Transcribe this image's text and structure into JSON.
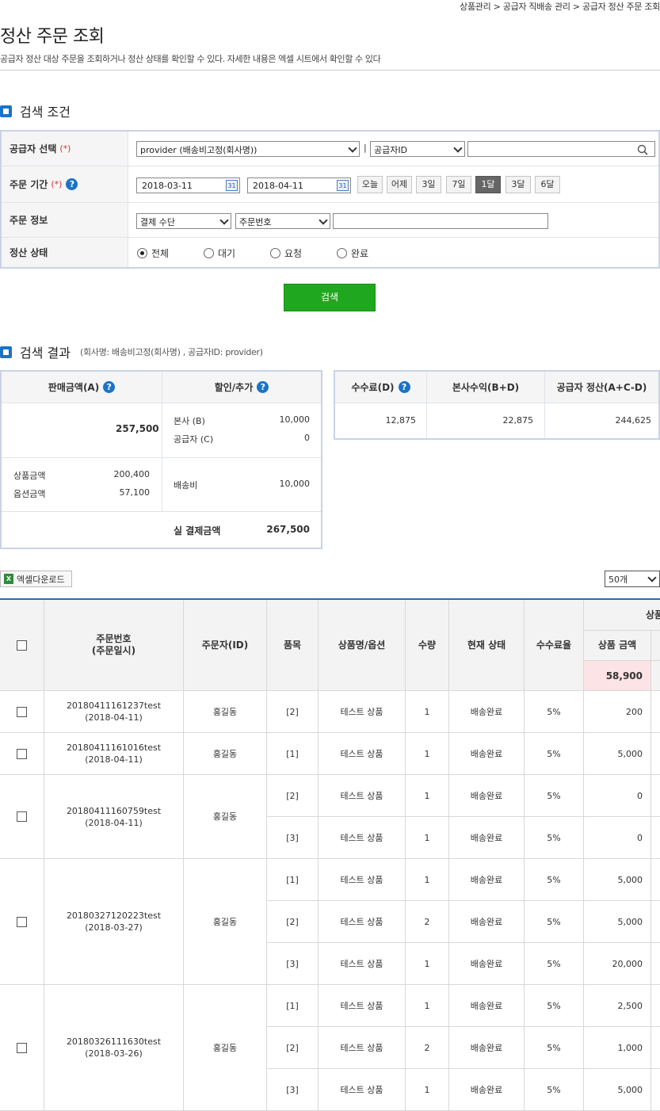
{
  "breadcrumb": "상품관리 > 공급자 직배송 관리 > 공급자 정산 주문 조회",
  "page": {
    "title": "정산 주문 조회",
    "description": "공급자 정산 대상 주문을 조회하거나 정산 상태를 확인할 수 있다. 자세한 내용은 엑셀 시트에서 확인할 수 있다"
  },
  "search": {
    "title": "검색 조건",
    "required_mark": "(*)",
    "supplier": {
      "label": "공급자 선택",
      "select_value": "provider (배송비고정(회사명))",
      "separator": "|",
      "type_value": "공급자ID",
      "input_value": ""
    },
    "period": {
      "label": "주문 기간",
      "start": "2018-03-11",
      "end": "2018-04-11",
      "calendar_glyph": "31",
      "buttons": [
        "오늘",
        "어제",
        "3일",
        "7일",
        "1달",
        "3달",
        "6달"
      ],
      "active": "1달"
    },
    "order_info": {
      "label": "주문 정보",
      "payment_value": "결제 수단",
      "field_value": "주문번호",
      "input_value": ""
    },
    "status": {
      "label": "정산 상태",
      "options": [
        "전체",
        "대기",
        "요청",
        "완료"
      ],
      "selected": "전체"
    },
    "submit": "검색"
  },
  "result": {
    "title": "검색 결과",
    "subtitle": "(회사명: 배송비고정(회사명) , 공급자ID: provider)",
    "help_glyph": "?",
    "sales": {
      "header_a": "판매금액(A)",
      "header_disc": "할인/추가",
      "total": "257,500",
      "hq_label": "본사 (B)",
      "hq_value": "10,000",
      "supplier_label": "공급자 (C)",
      "supplier_value": "0",
      "product_label": "상품금액",
      "product_value": "200,400",
      "option_label": "옵션금액",
      "option_value": "57,100",
      "shipping_label": "배송비",
      "shipping_value": "10,000",
      "paid_label": "실 결제금액",
      "paid_value": "267,500"
    },
    "fees": {
      "fee_label": "수수료(D)",
      "hq_profit_label": "본사수익(B+D)",
      "settle_label": "공급자 정산(A+C-D)",
      "fee_value": "12,875",
      "hq_profit_value": "22,875",
      "settle_value": "244,625"
    },
    "excel_label": "엑셀다운로드",
    "excel_icon": "X",
    "per_page": "50개"
  },
  "table": {
    "headers": {
      "order_no": "주문번호\n(주문일시)",
      "orderer": "주문자(ID)",
      "item": "품목",
      "product": "상품명/옵션",
      "qty": "수량",
      "state": "현재 상태",
      "fee_rate": "수수료율",
      "group": "상품",
      "amount": "상품 금액"
    },
    "total_amount": "58,900",
    "orders": [
      {
        "no": "20180411161237test",
        "date": "(2018-04-11)",
        "name": "홍길동",
        "items": [
          {
            "item": "[2]",
            "product": "테스트 상품",
            "qty": "1",
            "state": "배송완료",
            "rate": "5%",
            "amount": "200"
          }
        ]
      },
      {
        "no": "20180411161016test",
        "date": "(2018-04-11)",
        "name": "홍길동",
        "items": [
          {
            "item": "[1]",
            "product": "테스트 상품",
            "qty": "1",
            "state": "배송완료",
            "rate": "5%",
            "amount": "5,000"
          }
        ]
      },
      {
        "no": "20180411160759test",
        "date": "(2018-04-11)",
        "name": "홍길동",
        "items": [
          {
            "item": "[2]",
            "product": "테스트 상품",
            "qty": "1",
            "state": "배송완료",
            "rate": "5%",
            "amount": "0"
          },
          {
            "item": "[3]",
            "product": "테스트 상품",
            "qty": "1",
            "state": "배송완료",
            "rate": "5%",
            "amount": "0"
          }
        ]
      },
      {
        "no": "20180327120223test",
        "date": "(2018-03-27)",
        "name": "홍길동",
        "items": [
          {
            "item": "[1]",
            "product": "테스트 상품",
            "qty": "1",
            "state": "배송완료",
            "rate": "5%",
            "amount": "5,000"
          },
          {
            "item": "[2]",
            "product": "테스트 상품",
            "qty": "2",
            "state": "배송완료",
            "rate": "5%",
            "amount": "5,000"
          },
          {
            "item": "[3]",
            "product": "테스트 상품",
            "qty": "1",
            "state": "배송완료",
            "rate": "5%",
            "amount": "20,000"
          }
        ]
      },
      {
        "no": "20180326111630test",
        "date": "(2018-03-26)",
        "name": "홍길동",
        "items": [
          {
            "item": "[1]",
            "product": "테스트 상품",
            "qty": "1",
            "state": "배송완료",
            "rate": "5%",
            "amount": "2,500"
          },
          {
            "item": "[2]",
            "product": "테스트 상품",
            "qty": "2",
            "state": "배송완료",
            "rate": "5%",
            "amount": "1,000"
          },
          {
            "item": "[3]",
            "product": "테스트 상품",
            "qty": "1",
            "state": "배송완료",
            "rate": "5%",
            "amount": "5,000"
          }
        ]
      }
    ]
  }
}
